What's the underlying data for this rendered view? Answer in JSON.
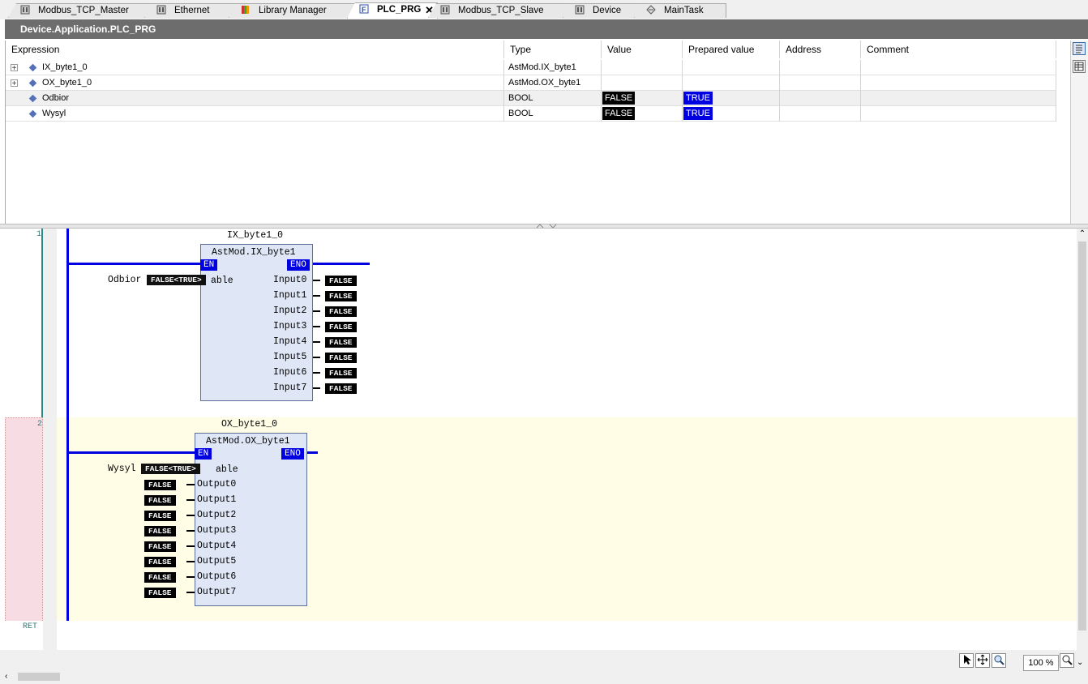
{
  "tabs": [
    {
      "label": "Modbus_TCP_Master",
      "icon": "device-icon"
    },
    {
      "label": "Ethernet",
      "icon": "device-icon"
    },
    {
      "label": "Library Manager",
      "icon": "library-icon"
    },
    {
      "label": "PLC_PRG",
      "icon": "program-icon",
      "close": "✕"
    },
    {
      "label": "Modbus_TCP_Slave",
      "icon": "device-icon"
    },
    {
      "label": "Device",
      "icon": "device-icon"
    },
    {
      "label": "MainTask",
      "icon": "task-icon"
    }
  ],
  "breadcrumb": "Device.Application.PLC_PRG",
  "watch": {
    "headers": [
      "Expression",
      "Type",
      "Value",
      "Prepared value",
      "Address",
      "Comment"
    ],
    "rows": [
      {
        "expand": "+",
        "expression": "IX_byte1_0",
        "type": "AstMod.IX_byte1",
        "value": "",
        "prepared": ""
      },
      {
        "expand": "+",
        "expression": "OX_byte1_0",
        "type": "AstMod.OX_byte1",
        "value": "",
        "prepared": ""
      },
      {
        "expand": "",
        "expression": "Odbior",
        "type": "BOOL",
        "value": "FALSE",
        "prepared": "TRUE"
      },
      {
        "expand": "",
        "expression": "Wysyl",
        "type": "BOOL",
        "value": "FALSE",
        "prepared": "TRUE"
      }
    ]
  },
  "networks": [
    {
      "number": "1",
      "instance": "IX_byte1_0",
      "type": "AstMod.IX_byte1",
      "en": "EN",
      "eno": "ENO",
      "input_var": "Odbior",
      "input_val": "FALSE<TRUE>",
      "input_pin": "able",
      "pins": [
        "Input0",
        "Input1",
        "Input2",
        "Input3",
        "Input4",
        "Input5",
        "Input6",
        "Input7"
      ],
      "values": [
        "FALSE",
        "FALSE",
        "FALSE",
        "FALSE",
        "FALSE",
        "FALSE",
        "FALSE",
        "FALSE"
      ]
    },
    {
      "number": "2",
      "instance": "OX_byte1_0",
      "type": "AstMod.OX_byte1",
      "en": "EN",
      "eno": "ENO",
      "input_var": "Wysyl",
      "input_val": "FALSE<TRUE>",
      "input_pin": "able",
      "pins": [
        "Output0",
        "Output1",
        "Output2",
        "Output3",
        "Output4",
        "Output5",
        "Output6",
        "Output7"
      ],
      "values": [
        "FALSE",
        "FALSE",
        "FALSE",
        "FALSE",
        "FALSE",
        "FALSE",
        "FALSE",
        "FALSE"
      ]
    }
  ],
  "ret_label": "RET",
  "zoom": "100 %",
  "colors": {
    "accent_blue": "#0000e0",
    "network_highlight": "#fffde6",
    "breakpoint": "#f7dde3",
    "block_fill": "#dfe7f6"
  }
}
